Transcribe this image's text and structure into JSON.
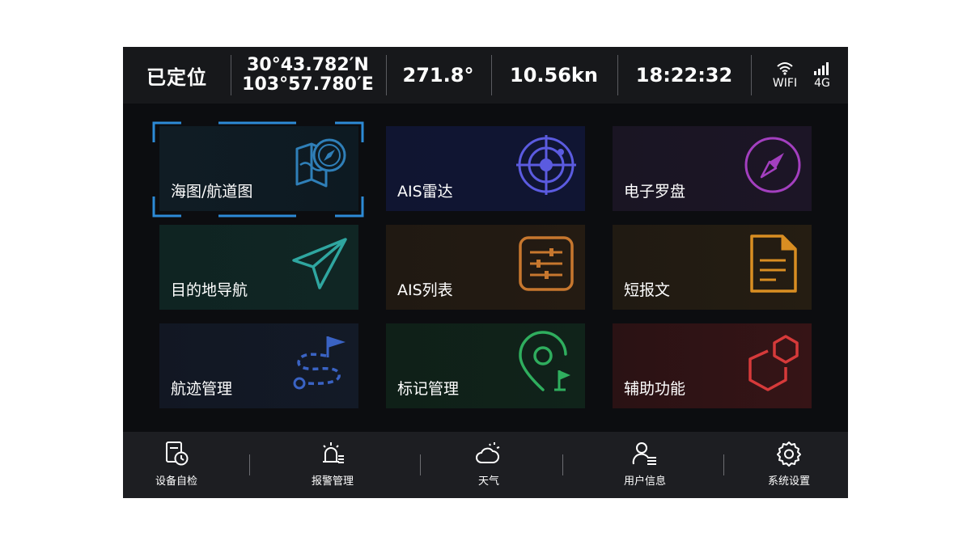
{
  "status_bar": {
    "gps_status": "已定位",
    "latitude": "30°43.782′N",
    "longitude": "103°57.780′E",
    "heading": "271.8°",
    "speed": "10.56kn",
    "time": "18:22:32",
    "wifi_label": "WIFI",
    "network_label": "4G"
  },
  "tiles": [
    {
      "label": "海图/航道图",
      "icon": "chart-map-icon",
      "accent": "#2f7fb8",
      "selected": true
    },
    {
      "label": "AIS雷达",
      "icon": "radar-icon",
      "accent": "#5b5be0"
    },
    {
      "label": "电子罗盘",
      "icon": "compass-icon",
      "accent": "#a33fbf"
    },
    {
      "label": "目的地导航",
      "icon": "paper-plane-icon",
      "accent": "#2fa6a0"
    },
    {
      "label": "AIS列表",
      "icon": "sliders-list-icon",
      "accent": "#c7772e"
    },
    {
      "label": "短报文",
      "icon": "document-icon",
      "accent": "#d98e22"
    },
    {
      "label": "航迹管理",
      "icon": "track-route-icon",
      "accent": "#3a63c4"
    },
    {
      "label": "标记管理",
      "icon": "map-pin-flag-icon",
      "accent": "#2fae5e"
    },
    {
      "label": "辅助功能",
      "icon": "hexagon-tools-icon",
      "accent": "#d63a3a"
    }
  ],
  "bottom_nav": [
    {
      "label": "设备自检",
      "icon": "device-check-icon"
    },
    {
      "label": "报警管理",
      "icon": "alarm-icon"
    },
    {
      "label": "天气",
      "icon": "weather-icon"
    },
    {
      "label": "用户信息",
      "icon": "user-info-icon"
    },
    {
      "label": "系统设置",
      "icon": "settings-gear-icon"
    }
  ]
}
